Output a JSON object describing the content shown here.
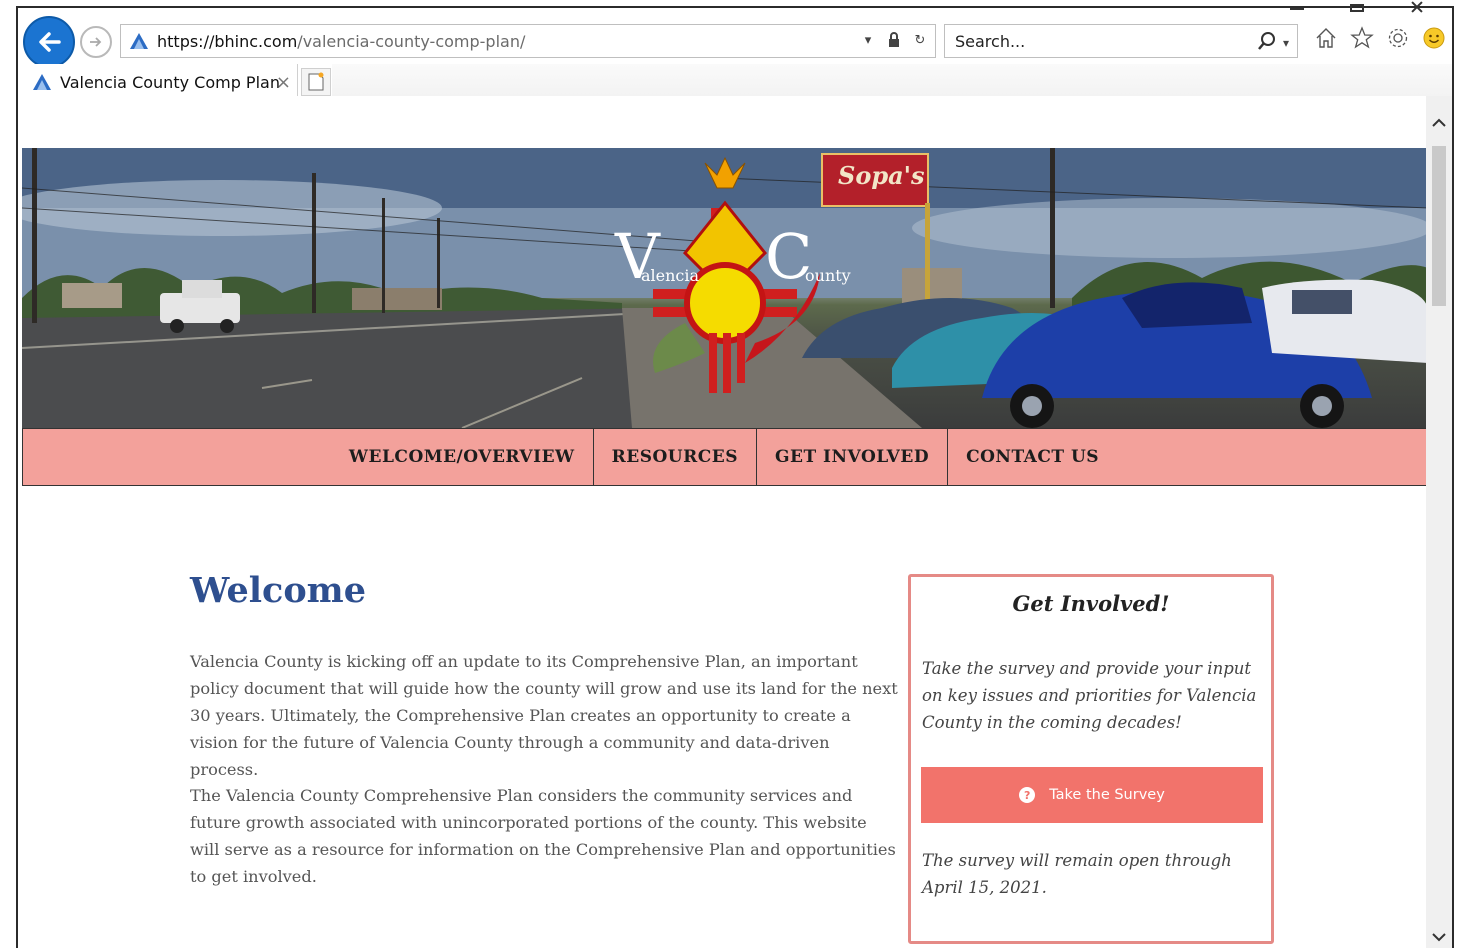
{
  "browser": {
    "url_host": "https://bhinc.com",
    "url_path": "/valencia-county-comp-plan/",
    "search_placeholder": "Search...",
    "tab_title": "Valencia County Comp Plan"
  },
  "site": {
    "nav": [
      "WELCOME/OVERVIEW",
      "RESOURCES",
      "GET INVOLVED",
      "CONTACT US"
    ],
    "logo": {
      "letter_v": "V",
      "word_v": "alencia",
      "letter_c": "C",
      "word_c": "ounty"
    },
    "sign_text": "Sopa's"
  },
  "main": {
    "title": "Welcome",
    "para1": "Valencia County is kicking off an update to its Comprehensive Plan, an important policy document that will guide how the county will grow and use its land for the next 30 years. Ultimately, the Comprehensive Plan creates an opportunity to create a vision for the future of Valencia County through a community and data-driven process.",
    "para2": "The Valencia County Comprehensive Plan considers the community services and future growth associated with unincorporated portions of the county. This website will serve as a resource for information on the Comprehensive Plan and opportunities to get involved."
  },
  "card": {
    "title": "Get Involved!",
    "text1": "Take the survey and provide your input on key issues and priorities for Valencia County in the coming decades!",
    "button": "Take the Survey",
    "text2": "The survey will remain open through April 15, 2021."
  },
  "colors": {
    "accent": "#f2736b",
    "nav_bg": "#f3a19b",
    "title": "#2e4f8f",
    "browser_blue": "#1b74d1"
  }
}
